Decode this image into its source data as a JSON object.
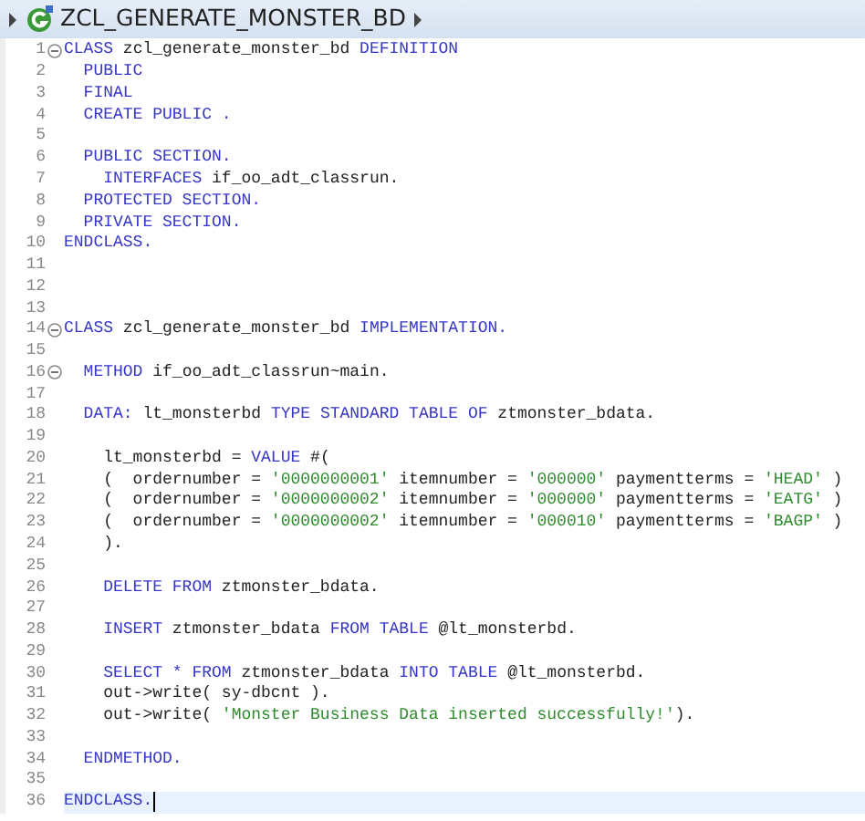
{
  "breadcrumb": {
    "title": "ZCL_GENERATE_MONSTER_BD"
  },
  "lines": [
    {
      "number": "1",
      "fold": true,
      "current": false,
      "tokens": [
        {
          "kind": "keyword",
          "text": "CLASS"
        },
        {
          "kind": "plain",
          "text": " zcl_generate_monster_bd "
        },
        {
          "kind": "keyword",
          "text": "DEFINITION"
        }
      ]
    },
    {
      "number": "2",
      "fold": false,
      "current": false,
      "tokens": [
        {
          "kind": "keyword",
          "text": "  PUBLIC"
        }
      ]
    },
    {
      "number": "3",
      "fold": false,
      "current": false,
      "tokens": [
        {
          "kind": "keyword",
          "text": "  FINAL"
        }
      ]
    },
    {
      "number": "4",
      "fold": false,
      "current": false,
      "tokens": [
        {
          "kind": "keyword",
          "text": "  CREATE PUBLIC ."
        }
      ]
    },
    {
      "number": "5",
      "fold": false,
      "current": false
    },
    {
      "number": "6",
      "fold": false,
      "current": false,
      "tokens": [
        {
          "kind": "keyword",
          "text": "  PUBLIC SECTION."
        }
      ]
    },
    {
      "number": "7",
      "fold": false,
      "current": false,
      "tokens": [
        {
          "kind": "keyword",
          "text": "    INTERFACES"
        },
        {
          "kind": "plain",
          "text": " if_oo_adt_classrun."
        }
      ]
    },
    {
      "number": "8",
      "fold": false,
      "current": false,
      "tokens": [
        {
          "kind": "keyword",
          "text": "  PROTECTED SECTION."
        }
      ]
    },
    {
      "number": "9",
      "fold": false,
      "current": false,
      "tokens": [
        {
          "kind": "keyword",
          "text": "  PRIVATE SECTION."
        }
      ]
    },
    {
      "number": "10",
      "fold": false,
      "current": false,
      "tokens": [
        {
          "kind": "keyword",
          "text": "ENDCLASS."
        }
      ]
    },
    {
      "number": "11",
      "fold": false,
      "current": false
    },
    {
      "number": "12",
      "fold": false,
      "current": false
    },
    {
      "number": "13",
      "fold": false,
      "current": false
    },
    {
      "number": "14",
      "fold": true,
      "current": false,
      "tokens": [
        {
          "kind": "keyword",
          "text": "CLASS"
        },
        {
          "kind": "plain",
          "text": " zcl_generate_monster_bd "
        },
        {
          "kind": "keyword",
          "text": "IMPLEMENTATION."
        }
      ]
    },
    {
      "number": "15",
      "fold": false,
      "current": false
    },
    {
      "number": "16",
      "fold": true,
      "current": false,
      "tokens": [
        {
          "kind": "keyword",
          "text": "  METHOD"
        },
        {
          "kind": "plain",
          "text": " if_oo_adt_classrun~main."
        }
      ]
    },
    {
      "number": "17",
      "fold": false,
      "current": false
    },
    {
      "number": "18",
      "fold": false,
      "current": false,
      "tokens": [
        {
          "kind": "keyword",
          "text": "  DATA:"
        },
        {
          "kind": "plain",
          "text": " lt_monsterbd "
        },
        {
          "kind": "keyword",
          "text": "TYPE STANDARD TABLE OF"
        },
        {
          "kind": "plain",
          "text": " ztmonster_bdata."
        }
      ]
    },
    {
      "number": "19",
      "fold": false,
      "current": false
    },
    {
      "number": "20",
      "fold": false,
      "current": false,
      "tokens": [
        {
          "kind": "plain",
          "text": "    lt_monsterbd = "
        },
        {
          "kind": "keyword",
          "text": "VALUE"
        },
        {
          "kind": "plain",
          "text": " #("
        }
      ]
    },
    {
      "number": "21",
      "fold": false,
      "current": false,
      "tokens": [
        {
          "kind": "plain",
          "text": "    (  ordernumber = "
        },
        {
          "kind": "string",
          "text": "'0000000001'"
        },
        {
          "kind": "plain",
          "text": " itemnumber = "
        },
        {
          "kind": "string",
          "text": "'000000'"
        },
        {
          "kind": "plain",
          "text": " paymentterms = "
        },
        {
          "kind": "string",
          "text": "'HEAD'"
        },
        {
          "kind": "plain",
          "text": " )"
        }
      ]
    },
    {
      "number": "22",
      "fold": false,
      "current": false,
      "tokens": [
        {
          "kind": "plain",
          "text": "    (  ordernumber = "
        },
        {
          "kind": "string",
          "text": "'0000000002'"
        },
        {
          "kind": "plain",
          "text": " itemnumber = "
        },
        {
          "kind": "string",
          "text": "'000000'"
        },
        {
          "kind": "plain",
          "text": " paymentterms = "
        },
        {
          "kind": "string",
          "text": "'EATG'"
        },
        {
          "kind": "plain",
          "text": " )"
        }
      ]
    },
    {
      "number": "23",
      "fold": false,
      "current": false,
      "tokens": [
        {
          "kind": "plain",
          "text": "    (  ordernumber = "
        },
        {
          "kind": "string",
          "text": "'0000000002'"
        },
        {
          "kind": "plain",
          "text": " itemnumber = "
        },
        {
          "kind": "string",
          "text": "'000010'"
        },
        {
          "kind": "plain",
          "text": " paymentterms = "
        },
        {
          "kind": "string",
          "text": "'BAGP'"
        },
        {
          "kind": "plain",
          "text": " )"
        }
      ]
    },
    {
      "number": "24",
      "fold": false,
      "current": false,
      "tokens": [
        {
          "kind": "plain",
          "text": "    )."
        }
      ]
    },
    {
      "number": "25",
      "fold": false,
      "current": false
    },
    {
      "number": "26",
      "fold": false,
      "current": false,
      "tokens": [
        {
          "kind": "keyword",
          "text": "    DELETE FROM"
        },
        {
          "kind": "plain",
          "text": " ztmonster_bdata."
        }
      ]
    },
    {
      "number": "27",
      "fold": false,
      "current": false
    },
    {
      "number": "28",
      "fold": false,
      "current": false,
      "tokens": [
        {
          "kind": "keyword",
          "text": "    INSERT"
        },
        {
          "kind": "plain",
          "text": " ztmonster_bdata "
        },
        {
          "kind": "keyword",
          "text": "FROM TABLE"
        },
        {
          "kind": "plain",
          "text": " @lt_monsterbd."
        }
      ]
    },
    {
      "number": "29",
      "fold": false,
      "current": false
    },
    {
      "number": "30",
      "fold": false,
      "current": false,
      "tokens": [
        {
          "kind": "keyword",
          "text": "    SELECT * FROM"
        },
        {
          "kind": "plain",
          "text": " ztmonster_bdata "
        },
        {
          "kind": "keyword",
          "text": "INTO TABLE"
        },
        {
          "kind": "plain",
          "text": " @lt_monsterbd."
        }
      ]
    },
    {
      "number": "31",
      "fold": false,
      "current": false,
      "tokens": [
        {
          "kind": "plain",
          "text": "    out->write( sy-dbcnt )."
        }
      ]
    },
    {
      "number": "32",
      "fold": false,
      "current": false,
      "tokens": [
        {
          "kind": "plain",
          "text": "    out->write( "
        },
        {
          "kind": "string",
          "text": "'Monster Business Data inserted successfully!'"
        },
        {
          "kind": "plain",
          "text": ")."
        }
      ]
    },
    {
      "number": "33",
      "fold": false,
      "current": false
    },
    {
      "number": "34",
      "fold": false,
      "current": false,
      "tokens": [
        {
          "kind": "keyword",
          "text": "  ENDMETHOD."
        }
      ]
    },
    {
      "number": "35",
      "fold": false,
      "current": false
    },
    {
      "number": "36",
      "fold": false,
      "current": true,
      "tokens": [
        {
          "kind": "keyword",
          "text": "ENDCLASS."
        }
      ]
    }
  ]
}
